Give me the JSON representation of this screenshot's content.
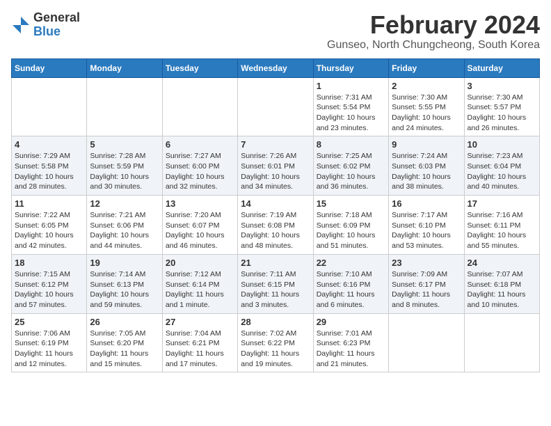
{
  "logo": {
    "general": "General",
    "blue": "Blue"
  },
  "title": "February 2024",
  "subtitle": "Gunseo, North Chungcheong, South Korea",
  "days_of_week": [
    "Sunday",
    "Monday",
    "Tuesday",
    "Wednesday",
    "Thursday",
    "Friday",
    "Saturday"
  ],
  "weeks": [
    [
      {
        "day": "",
        "info": ""
      },
      {
        "day": "",
        "info": ""
      },
      {
        "day": "",
        "info": ""
      },
      {
        "day": "",
        "info": ""
      },
      {
        "day": "1",
        "info": "Sunrise: 7:31 AM\nSunset: 5:54 PM\nDaylight: 10 hours and 23 minutes."
      },
      {
        "day": "2",
        "info": "Sunrise: 7:30 AM\nSunset: 5:55 PM\nDaylight: 10 hours and 24 minutes."
      },
      {
        "day": "3",
        "info": "Sunrise: 7:30 AM\nSunset: 5:57 PM\nDaylight: 10 hours and 26 minutes."
      }
    ],
    [
      {
        "day": "4",
        "info": "Sunrise: 7:29 AM\nSunset: 5:58 PM\nDaylight: 10 hours and 28 minutes."
      },
      {
        "day": "5",
        "info": "Sunrise: 7:28 AM\nSunset: 5:59 PM\nDaylight: 10 hours and 30 minutes."
      },
      {
        "day": "6",
        "info": "Sunrise: 7:27 AM\nSunset: 6:00 PM\nDaylight: 10 hours and 32 minutes."
      },
      {
        "day": "7",
        "info": "Sunrise: 7:26 AM\nSunset: 6:01 PM\nDaylight: 10 hours and 34 minutes."
      },
      {
        "day": "8",
        "info": "Sunrise: 7:25 AM\nSunset: 6:02 PM\nDaylight: 10 hours and 36 minutes."
      },
      {
        "day": "9",
        "info": "Sunrise: 7:24 AM\nSunset: 6:03 PM\nDaylight: 10 hours and 38 minutes."
      },
      {
        "day": "10",
        "info": "Sunrise: 7:23 AM\nSunset: 6:04 PM\nDaylight: 10 hours and 40 minutes."
      }
    ],
    [
      {
        "day": "11",
        "info": "Sunrise: 7:22 AM\nSunset: 6:05 PM\nDaylight: 10 hours and 42 minutes."
      },
      {
        "day": "12",
        "info": "Sunrise: 7:21 AM\nSunset: 6:06 PM\nDaylight: 10 hours and 44 minutes."
      },
      {
        "day": "13",
        "info": "Sunrise: 7:20 AM\nSunset: 6:07 PM\nDaylight: 10 hours and 46 minutes."
      },
      {
        "day": "14",
        "info": "Sunrise: 7:19 AM\nSunset: 6:08 PM\nDaylight: 10 hours and 48 minutes."
      },
      {
        "day": "15",
        "info": "Sunrise: 7:18 AM\nSunset: 6:09 PM\nDaylight: 10 hours and 51 minutes."
      },
      {
        "day": "16",
        "info": "Sunrise: 7:17 AM\nSunset: 6:10 PM\nDaylight: 10 hours and 53 minutes."
      },
      {
        "day": "17",
        "info": "Sunrise: 7:16 AM\nSunset: 6:11 PM\nDaylight: 10 hours and 55 minutes."
      }
    ],
    [
      {
        "day": "18",
        "info": "Sunrise: 7:15 AM\nSunset: 6:12 PM\nDaylight: 10 hours and 57 minutes."
      },
      {
        "day": "19",
        "info": "Sunrise: 7:14 AM\nSunset: 6:13 PM\nDaylight: 10 hours and 59 minutes."
      },
      {
        "day": "20",
        "info": "Sunrise: 7:12 AM\nSunset: 6:14 PM\nDaylight: 11 hours and 1 minute."
      },
      {
        "day": "21",
        "info": "Sunrise: 7:11 AM\nSunset: 6:15 PM\nDaylight: 11 hours and 3 minutes."
      },
      {
        "day": "22",
        "info": "Sunrise: 7:10 AM\nSunset: 6:16 PM\nDaylight: 11 hours and 6 minutes."
      },
      {
        "day": "23",
        "info": "Sunrise: 7:09 AM\nSunset: 6:17 PM\nDaylight: 11 hours and 8 minutes."
      },
      {
        "day": "24",
        "info": "Sunrise: 7:07 AM\nSunset: 6:18 PM\nDaylight: 11 hours and 10 minutes."
      }
    ],
    [
      {
        "day": "25",
        "info": "Sunrise: 7:06 AM\nSunset: 6:19 PM\nDaylight: 11 hours and 12 minutes."
      },
      {
        "day": "26",
        "info": "Sunrise: 7:05 AM\nSunset: 6:20 PM\nDaylight: 11 hours and 15 minutes."
      },
      {
        "day": "27",
        "info": "Sunrise: 7:04 AM\nSunset: 6:21 PM\nDaylight: 11 hours and 17 minutes."
      },
      {
        "day": "28",
        "info": "Sunrise: 7:02 AM\nSunset: 6:22 PM\nDaylight: 11 hours and 19 minutes."
      },
      {
        "day": "29",
        "info": "Sunrise: 7:01 AM\nSunset: 6:23 PM\nDaylight: 11 hours and 21 minutes."
      },
      {
        "day": "",
        "info": ""
      },
      {
        "day": "",
        "info": ""
      }
    ]
  ]
}
